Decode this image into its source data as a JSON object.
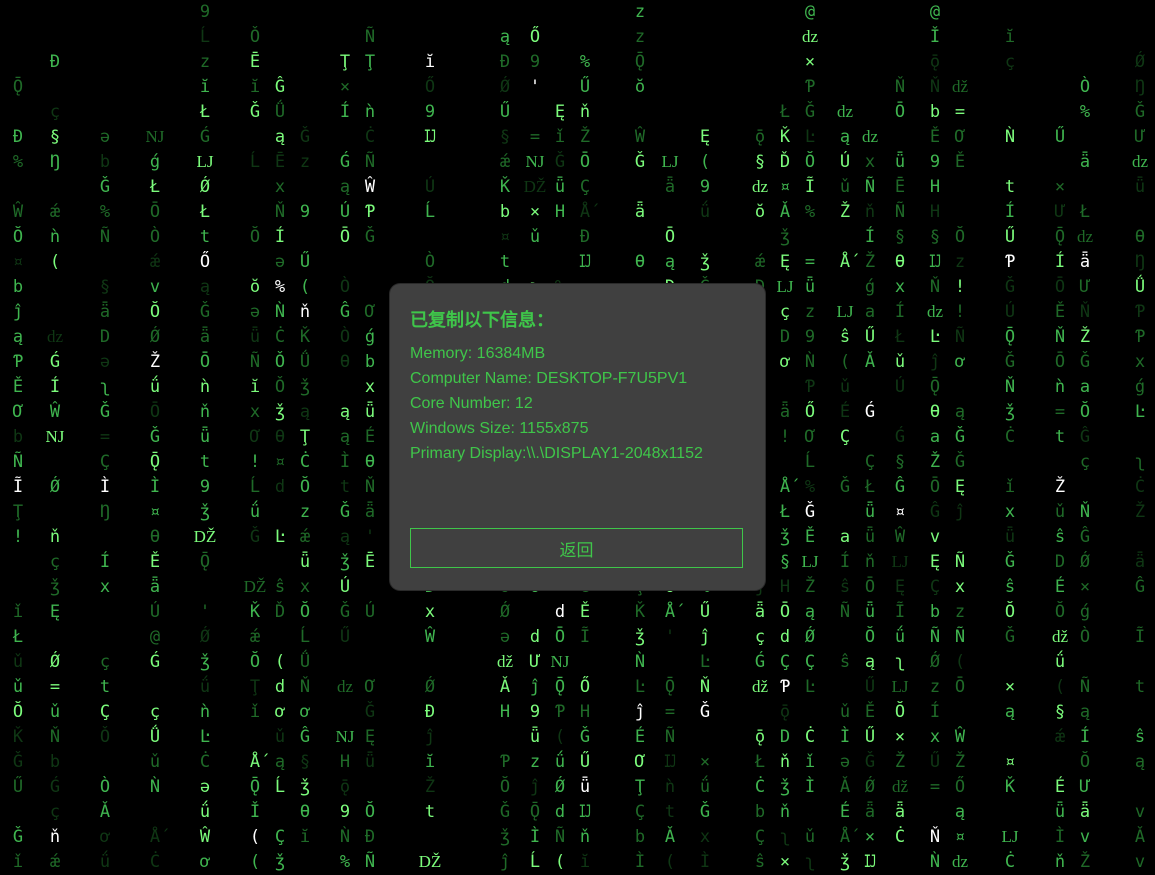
{
  "background": {
    "rain_glyphs": [
      "ǯ",
      "ĭ",
      "ǝ",
      "ʅ",
      "É",
      "¤",
      "9",
      "b",
      "Ǿ",
      "Ǘ",
      "t",
      "H",
      "b",
      "Ǌ",
      "z",
      "ǟ",
      "(",
      "Ĝ",
      "ĵ",
      "a",
      "D",
      "@",
      "!",
      "Ŵ",
      "Ú",
      "ǟ",
      "Ę",
      "Ò",
      "×",
      "Ĺ",
      "=",
      "Ǆ",
      "Ł",
      "v",
      "Ì",
      "Ǧ",
      "Ǐ",
      "Ō",
      "ǘ",
      "Ç",
      "Ň",
      "ň",
      "'",
      "ǔ",
      "Ǭ",
      "ç",
      "§",
      "ŏ",
      "Í",
      "Ǵ",
      "x",
      "ą",
      "Ž",
      "Ď",
      "Ě",
      "Ñ",
      "Ŏ",
      "Ċ",
      "Đ",
      "Ĳ",
      "Ĩ",
      "Ō",
      "ơ",
      "ǝ",
      "Ű",
      "Ǧ",
      "d",
      "ą",
      "ǐ",
      "ǖ",
      "ǽ",
      "ǆ",
      "Ǒ",
      "Ǎ",
      "Ŏ",
      "Ţ",
      "Ǩ",
      "Ơ",
      "%",
      "Ŀ",
      "ŝ",
      "Ő",
      "Ǿ",
      "ǳ",
      "Ē",
      "Ư",
      "ǹ",
      "Ǹ",
      "Ñ",
      "Ŋ",
      "Ň",
      "ǖ",
      "Ǧ",
      "ǯ",
      "Ǉ",
      "ǭ",
      "ǵ",
      "Ɵ",
      "Ƥ",
      "Ǻ"
    ],
    "accent_color": "#3fc64a"
  },
  "dialog": {
    "title": "已复制以下信息：",
    "lines": [
      "Memory: 16384MB",
      "Computer Name: DESKTOP-F7U5PV1",
      "Core Number: 12",
      "Windows Size: 1155x875",
      "Primary Display:\\\\.\\DISPLAY1-2048x1152"
    ],
    "back_label": "返回"
  }
}
